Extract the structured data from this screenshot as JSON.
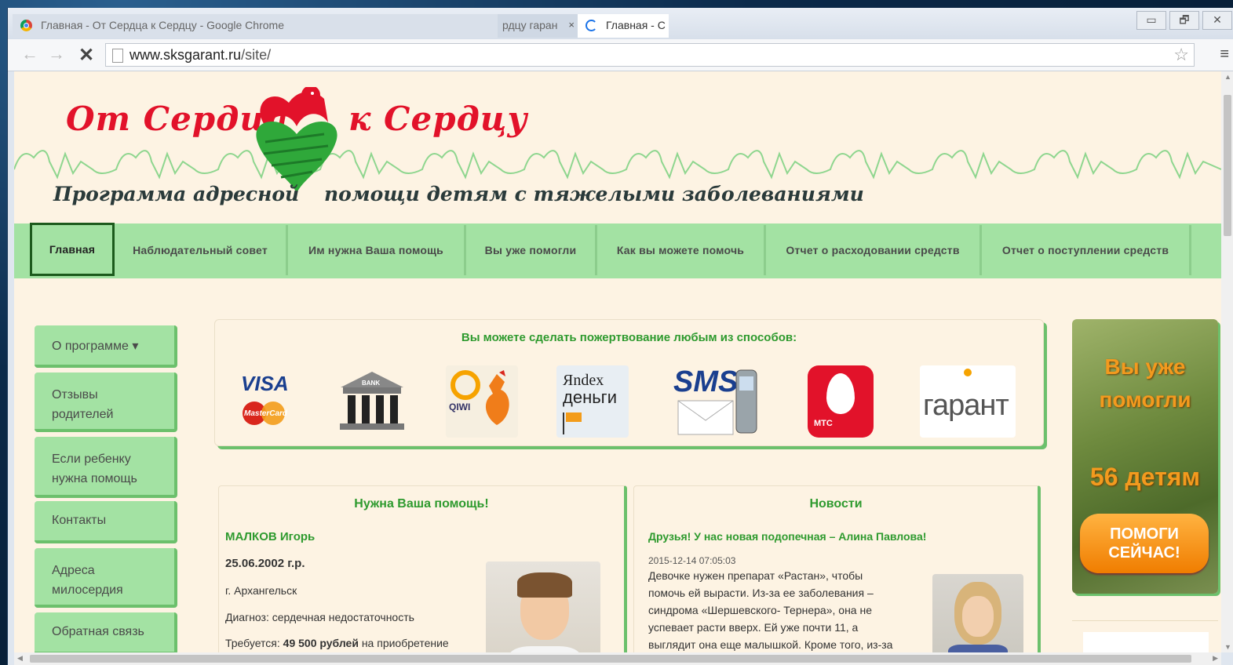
{
  "browser": {
    "tabs": [
      {
        "title": "Главная - От Сердца к Сердцу - Google Chrome"
      },
      {
        "title": "рдцу гаран",
        "close": "×"
      },
      {
        "title": "Главная - С"
      }
    ],
    "window_buttons": [
      "▭",
      "🗗",
      "✕"
    ],
    "url_host": "www.sksgarant.ru",
    "url_path": "/site/"
  },
  "header": {
    "logo_left": "От Сердца",
    "logo_right": "к Сердцу",
    "tagline_left": "Программа адресной",
    "tagline_right": "помощи детям с тяжелыми заболеваниями"
  },
  "nav": {
    "items": [
      {
        "label": "Главная"
      },
      {
        "label": "Наблюдательный совет"
      },
      {
        "label": "Им нужна Ваша помощь"
      },
      {
        "label": "Вы уже помогли"
      },
      {
        "label": "Как вы можете помочь"
      },
      {
        "label": "Отчет о расходовании средств"
      },
      {
        "label": "Отчет о поступлении средств"
      }
    ]
  },
  "sidebar": {
    "items": [
      {
        "line1": "О программе ▾",
        "line2": ""
      },
      {
        "line1": "Отзывы",
        "line2": "родителей"
      },
      {
        "line1": "Если ребенку",
        "line2": "нужна помощь"
      },
      {
        "line1": "Контакты",
        "line2": ""
      },
      {
        "line1": "Адреса",
        "line2": "милосердия"
      },
      {
        "line1": "Обратная связь",
        "line2": ""
      }
    ]
  },
  "donate": {
    "title": "Вы можете сделать пожертвование любым из способов:",
    "methods": {
      "visa": "VISA",
      "mastercard": "MasterCard",
      "bank": "BANK",
      "qiwi": "QIWI",
      "yandex_top": "Яndex",
      "yandex_bottom": "деньги",
      "sms": "SMS",
      "mts": "МТС",
      "garant": "гарант"
    }
  },
  "help_panel": {
    "title": "Нужна Ваша помощь!",
    "name": "МАЛКОВ Игорь",
    "birth": "25.06.2002 г.р.",
    "city": "г. Архангельск",
    "diagnosis": "Диагноз: сердечная недостаточность",
    "required_prefix": "Требуется: ",
    "required_amount": "49 500 рублей",
    "required_suffix": " на приобретение"
  },
  "news_panel": {
    "title": "Новости",
    "headline": "Друзья! У нас новая подопечная – Алина Павлова!",
    "date": "2015-12-14 07:05:03",
    "lines": [
      "Девочке нужен препарат «Растан», чтобы",
      "помочь ей вырасти. Из-за ее заболевания –",
      "синдрома «Шершевского- Тернера», она не",
      "успевает расти вверх. Ей уже почти 11, а",
      "выглядит она еще малышкой. Кроме того, из-за"
    ]
  },
  "banner": {
    "line1": "Вы уже",
    "line2": "помогли",
    "line3": "56 детям",
    "cta_line1": "ПОМОГИ",
    "cta_line2": "СЕЙЧАС!"
  }
}
